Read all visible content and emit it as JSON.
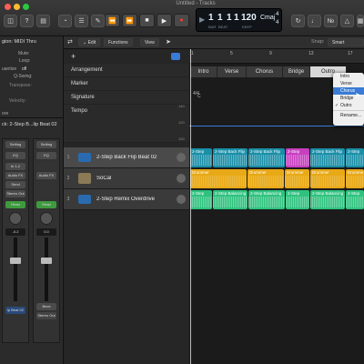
{
  "window": {
    "title": "Untitled - Tracks"
  },
  "lcd": {
    "bar": "1",
    "beat": "1",
    "div": "1",
    "tick": "1",
    "bar_label": "BAR",
    "beat_label": "BEAT",
    "tempo": "120",
    "tempo_label": "KEEP",
    "key": "Cmaj",
    "sig_top": "4",
    "sig_bottom": "4"
  },
  "inspector": {
    "region_label": "gion: MIDI Thru",
    "rows": [
      "Mute:",
      "Loop:",
      "uantize",
      "Q-Swing:",
      "Transpose:",
      "Velocity:",
      "ore"
    ],
    "quantize_value": "off",
    "track_label": "ck: 2-Step B...lip Beat 02",
    "strip1": {
      "setting": "Setting",
      "eq": "EQ",
      "input": "In 1-2",
      "fx": "Audio FX",
      "send": "Send",
      "output": "Stereo Out",
      "group": "Read",
      "volume": "-0.2",
      "name": "ip Beat 02"
    },
    "strip2": {
      "setting": "Setting",
      "eq": "EQ",
      "input": "",
      "fx": "Audio FX",
      "send": "",
      "output": "",
      "group": "Read",
      "volume": "0.0",
      "bnce": "Bnce",
      "name": "Stereo Out"
    }
  },
  "toolbar": {
    "edit": "Edit",
    "functions": "Functions",
    "view": "View",
    "snap_label": "Snap:",
    "snap_value": "Smart"
  },
  "global_tracks": [
    "Arrangement",
    "Marker",
    "Signature",
    "Tempo"
  ],
  "tempo_ticks": [
    "140",
    "120",
    "100"
  ],
  "signature_text": "4/4",
  "key_text": "C",
  "ruler": [
    "1",
    "5",
    "9",
    "13",
    "17"
  ],
  "arrangement": [
    "Intro",
    "Verse",
    "Chorus",
    "Bridge",
    "Outro"
  ],
  "tracks": [
    {
      "num": "1",
      "name": "2-Step Back Flip Beat 02"
    },
    {
      "num": "2",
      "name": "SoCal"
    },
    {
      "num": "3",
      "name": "2-Step Remix Overdrive"
    }
  ],
  "regions": {
    "row1": [
      "2-Step",
      "2-Step Back Flip",
      "2-Step Back Flip",
      "2-Step",
      "2-Step Back Flip",
      "2-Step"
    ],
    "row2": [
      "Drummer",
      "Drummer",
      "Drummer",
      "Drummer",
      "Drumme"
    ],
    "row3": [
      "2-Step",
      "2-Step Balancing",
      "2-Step Balancing",
      "2-Step",
      "2-Step Balancing",
      "2-Step"
    ]
  },
  "dropdown": {
    "items": [
      "Intro",
      "Verse",
      "Chorus",
      "Bridge",
      "Outro",
      "Rename..."
    ],
    "checked": "Outro"
  },
  "colors": {
    "accent": "#3a7bd5",
    "yellow": "#e8a916",
    "green": "#2ec27e",
    "cyan": "#13b5c8",
    "magenta": "#d845c8"
  }
}
